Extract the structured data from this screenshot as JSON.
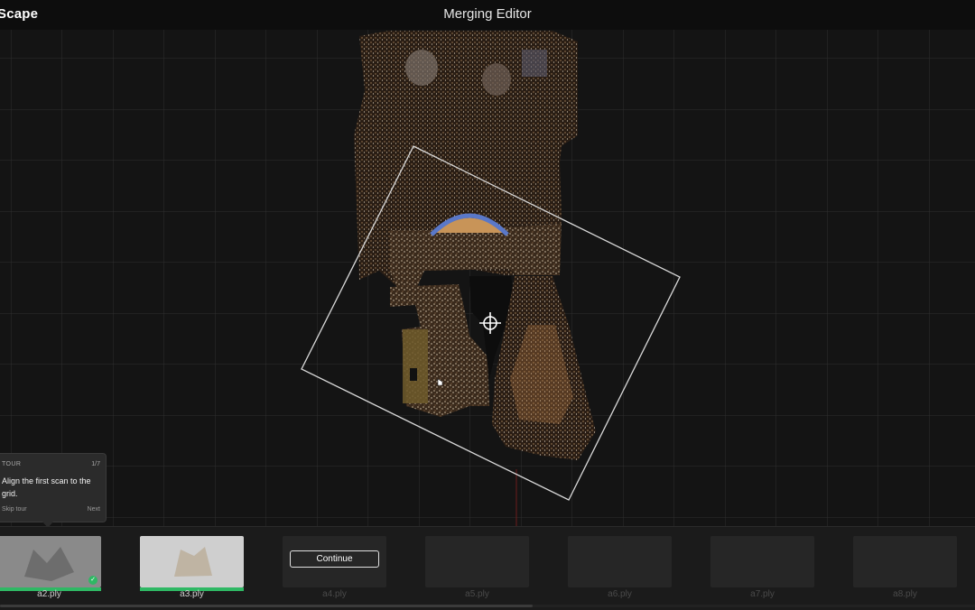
{
  "app": {
    "logo": "Scape",
    "title": "Merging Editor"
  },
  "tour": {
    "label": "TOUR",
    "count": "1/7",
    "message": "Align the first scan to the grid.",
    "skip": "Skip tour",
    "next": "Next"
  },
  "scans": [
    {
      "label": "a2.ply",
      "state": "done"
    },
    {
      "label": "a3.ply",
      "state": "active"
    },
    {
      "label": "a4.ply",
      "state": "pending"
    },
    {
      "label": "a5.ply",
      "state": "pending"
    },
    {
      "label": "a6.ply",
      "state": "pending"
    },
    {
      "label": "a7.ply",
      "state": "pending"
    },
    {
      "label": "a8.ply",
      "state": "pending"
    }
  ],
  "continue_label": "Continue",
  "icons": {
    "crosshair": "crosshair-icon",
    "check": "check-icon",
    "cursor": "hand-cursor-icon"
  }
}
